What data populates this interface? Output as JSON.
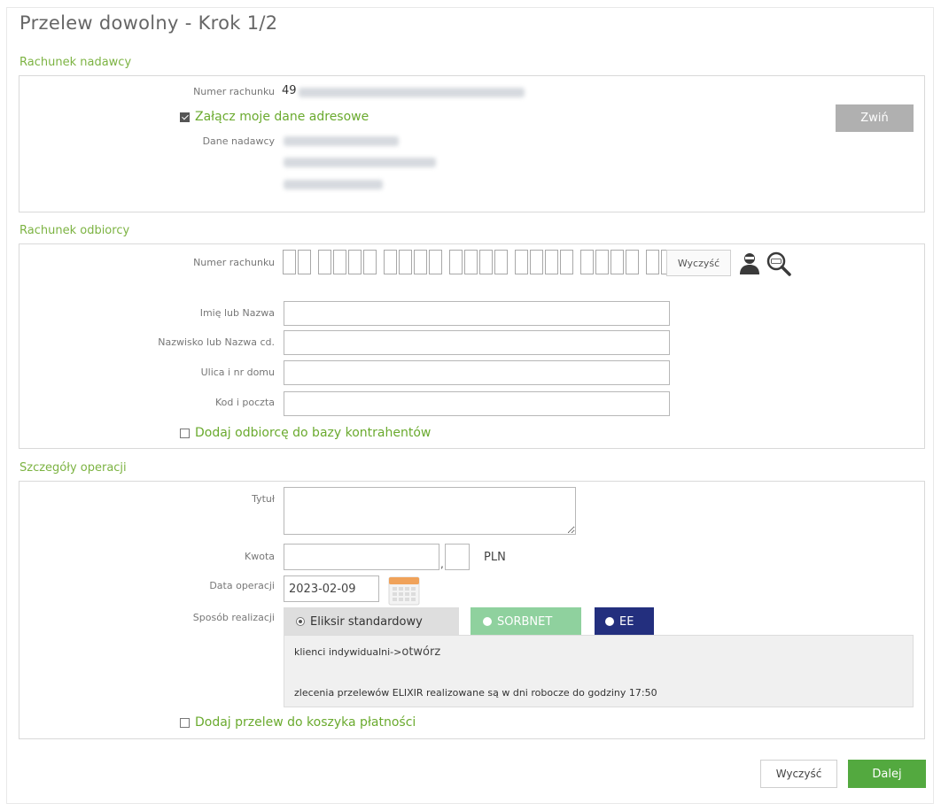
{
  "page": {
    "title": "Przelew dowolny - Krok 1/2"
  },
  "sender": {
    "section_title": "Rachunek nadawcy",
    "account_label": "Numer rachunku",
    "account_prefix": "49",
    "attach_address_label": "Załącz moje dane adresowe",
    "attach_address_checked": true,
    "sender_data_label": "Dane nadawcy",
    "collapse_button": "Zwiń"
  },
  "recipient": {
    "section_title": "Rachunek odbiorcy",
    "account_label": "Numer rachunku",
    "clear_button": "Wyczyść",
    "name_label": "Imię lub Nazwa",
    "name_value": "",
    "surname_label": "Nazwisko lub Nazwa cd.",
    "surname_value": "",
    "street_label": "Ulica i nr domu",
    "street_value": "",
    "postal_label": "Kod i poczta",
    "postal_value": "",
    "add_contractor_label": "Dodaj odbiorcę do bazy kontrahentów",
    "add_contractor_checked": false,
    "contacts_icon": "person-icon",
    "vat_lookup_icon": "vat-search-icon"
  },
  "details": {
    "section_title": "Szczegóły operacji",
    "title_label": "Tytuł",
    "title_value": "",
    "amount_label": "Kwota",
    "amount_value": "",
    "amount_cents": "",
    "currency": "PLN",
    "date_label": "Data operacji",
    "date_value": "2023-02-09",
    "calendar_icon": "calendar-icon",
    "mode_label": "Sposób realizacji",
    "modes": [
      {
        "label": "Eliksir standardowy",
        "selected": true
      },
      {
        "label": "SORBNET",
        "selected": false
      },
      {
        "label": "EE",
        "selected": false
      }
    ],
    "info_line1_prefix": "klienci indywidualni->",
    "info_line1_link": "otwórz",
    "info_line2": "zlecenia przelewów ELIXIR realizowane są w dni robocze do godziny 17:50",
    "add_basket_label": "Dodaj przelew do koszyka płatności",
    "add_basket_checked": false
  },
  "footer": {
    "clear_button": "Wyczyść",
    "next_button": "Dalej"
  },
  "colors": {
    "accent_green": "#7cb342",
    "next_button_bg": "#53a93f",
    "sorbnet_bg": "#8fd19e",
    "ee_bg": "#232f7e",
    "info_box_bg": "#f0f0f0"
  }
}
